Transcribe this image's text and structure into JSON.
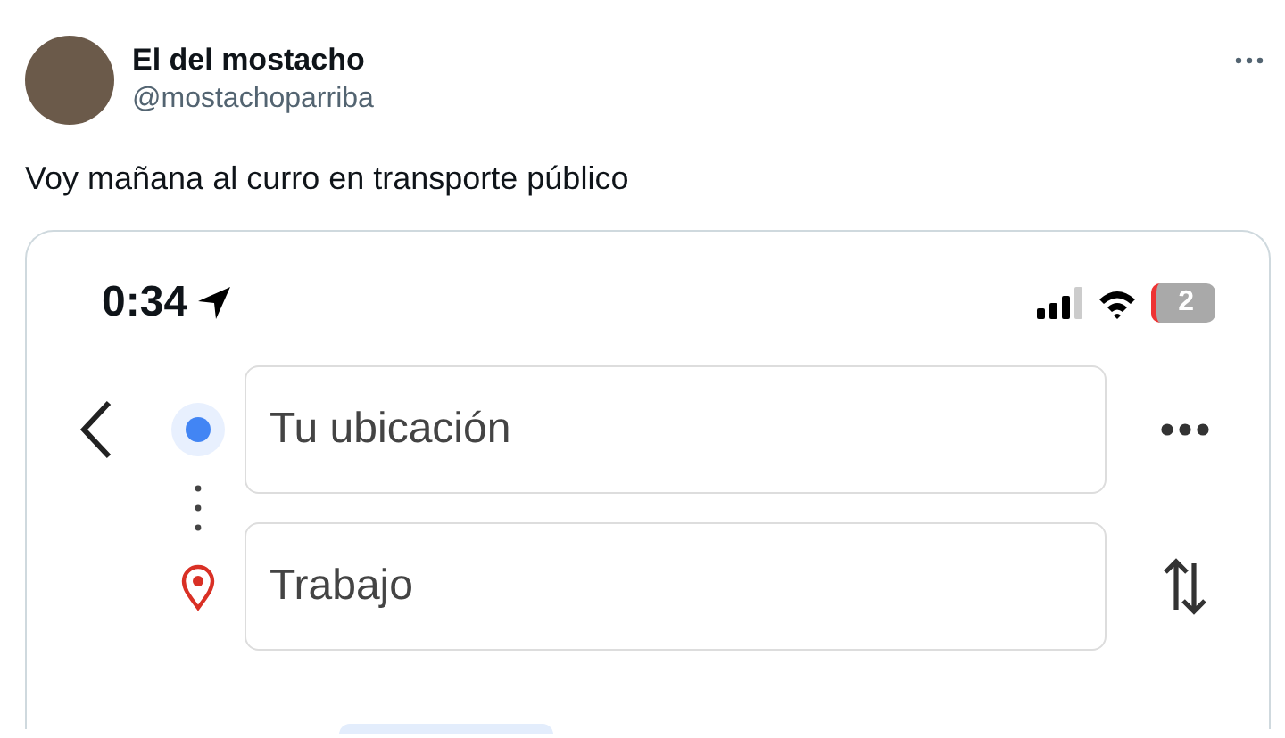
{
  "post": {
    "author": "El del mostacho",
    "handle": "@mostachoparriba",
    "text": "Voy mañana al curro en transporte público"
  },
  "screenshot": {
    "status_bar": {
      "time": "0:34",
      "battery": "2"
    },
    "route": {
      "origin": {
        "value": "Tu ubicación"
      },
      "destination": {
        "value": "Trabajo"
      }
    }
  }
}
